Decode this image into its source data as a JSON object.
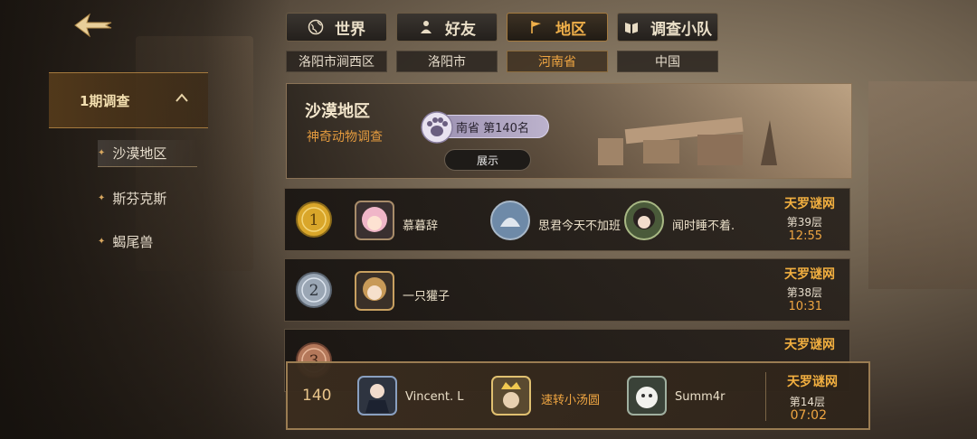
{
  "top_tabs": [
    {
      "label": "世界",
      "icon": "globe-icon",
      "active": false
    },
    {
      "label": "好友",
      "icon": "friends-icon",
      "active": false
    },
    {
      "label": "地区",
      "icon": "flag-icon",
      "active": true
    },
    {
      "label": "调查小队",
      "icon": "book-icon",
      "active": false
    }
  ],
  "sub_tabs": [
    {
      "label": "洛阳市涧西区",
      "active": false
    },
    {
      "label": "洛阳市",
      "active": false
    },
    {
      "label": "河南省",
      "active": true
    },
    {
      "label": "中国",
      "active": false
    }
  ],
  "sidebar": {
    "period_label": "1期调查",
    "items": [
      {
        "label": "沙漠地区",
        "active": true
      },
      {
        "label": "斯芬克斯",
        "active": false
      },
      {
        "label": "蝎尾兽",
        "active": false
      }
    ]
  },
  "banner": {
    "title": "沙漠地区",
    "subtitle": "神奇动物调查",
    "rank_text": "南省  第140名",
    "show_button": "展示"
  },
  "rows": [
    {
      "rank": "1",
      "medal_color": "#d9a62a",
      "players": [
        {
          "name": "慕暮辞",
          "icon": "pink-hair-avatar-icon"
        },
        {
          "name": "思君今天不加班",
          "icon": "cat-avatar-icon"
        },
        {
          "name": "闻时睡不着.",
          "icon": "dark-hair-avatar-icon"
        }
      ],
      "team": "天罗谜网",
      "floor": "第39层",
      "time": "12:55"
    },
    {
      "rank": "2",
      "medal_color": "#9aa6b4",
      "players": [
        {
          "name": "一只獾子",
          "icon": "blonde-avatar-icon"
        }
      ],
      "team": "天罗谜网",
      "floor": "第38层",
      "time": "10:31"
    },
    {
      "rank": "3",
      "medal_color": "#b4785a",
      "players": [],
      "team": "天罗谜网",
      "floor": "",
      "time": ""
    }
  ],
  "my_row": {
    "rank": "140",
    "players": [
      {
        "name": "Vincent. L",
        "icon": "suit-avatar-icon",
        "highlight": false
      },
      {
        "name": "速转小汤圆",
        "icon": "crown-avatar-icon",
        "highlight": true
      },
      {
        "name": "Summ4r",
        "icon": "white-creature-avatar-icon",
        "highlight": false
      }
    ],
    "team": "天罗谜网",
    "floor": "第14层",
    "time": "07:02"
  }
}
